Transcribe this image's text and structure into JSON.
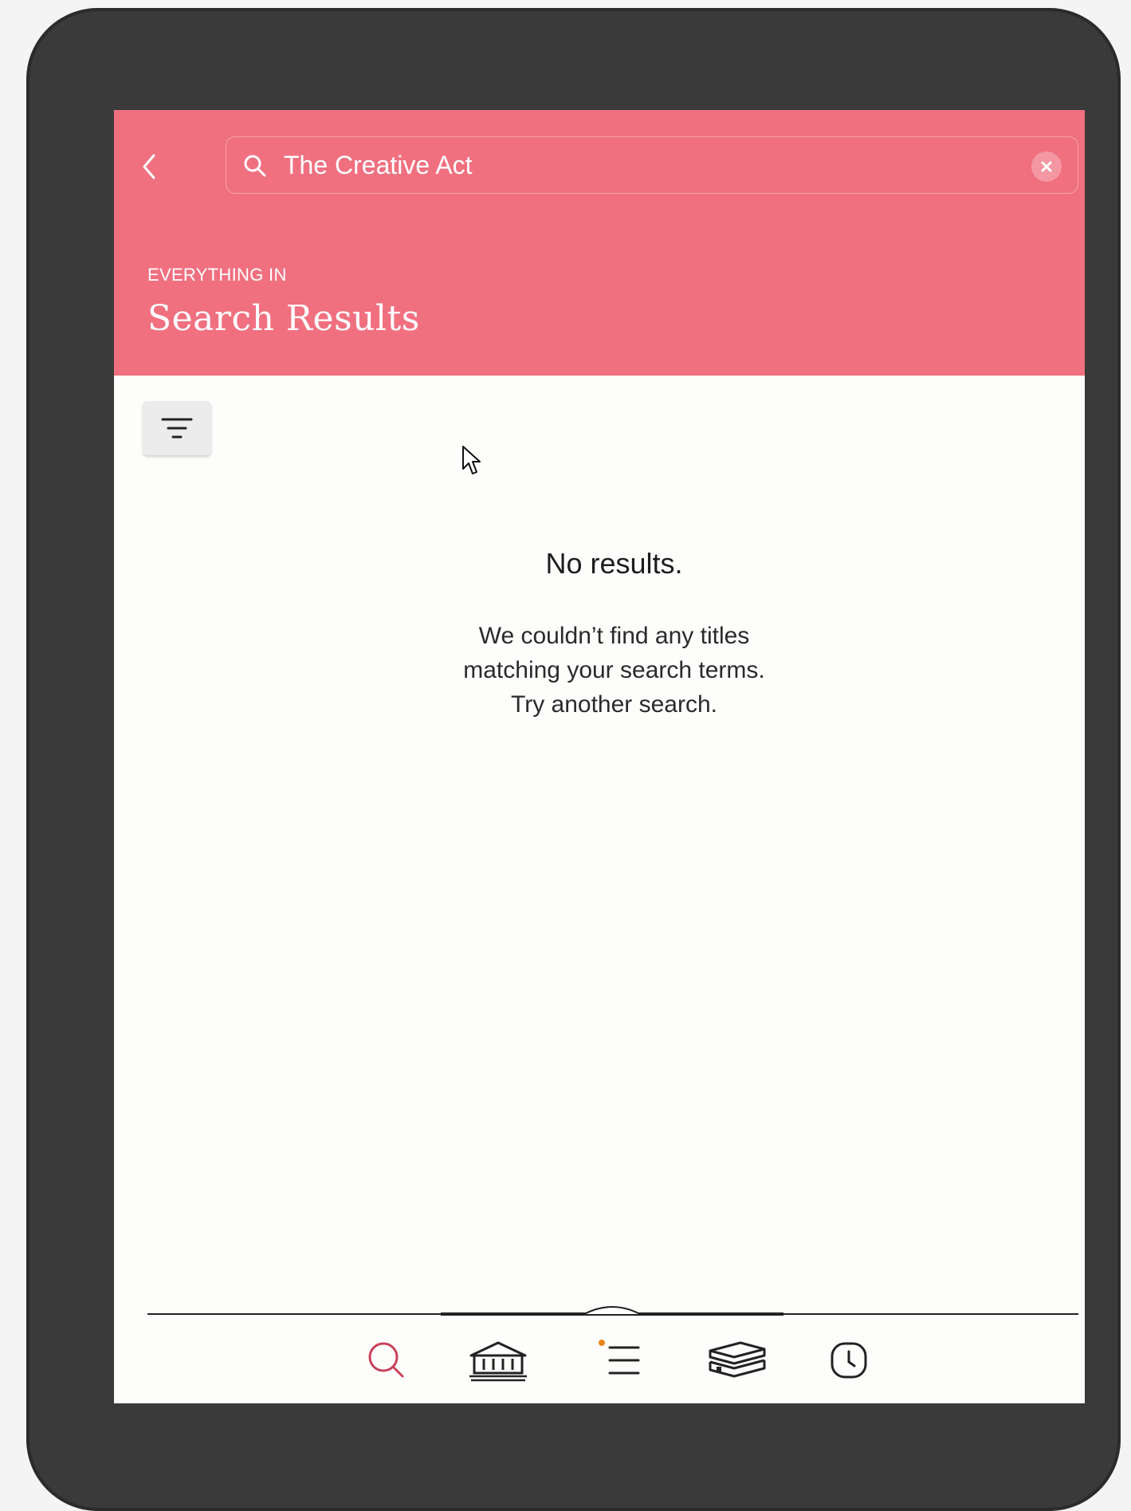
{
  "search": {
    "value": "The Creative Act",
    "placeholder": ""
  },
  "header": {
    "eyebrow": "EVERYTHING IN",
    "title": "Search Results"
  },
  "empty_state": {
    "title": "No results.",
    "lines": [
      "We couldn’t find any titles",
      "matching your search terms.",
      "Try another search."
    ]
  },
  "bottom_nav": {
    "items": [
      {
        "icon": "search-icon",
        "active": true
      },
      {
        "icon": "library-icon",
        "active": false
      },
      {
        "icon": "menu-list-icon",
        "active": false,
        "notification_dot": true
      },
      {
        "icon": "books-stack-icon",
        "active": false
      },
      {
        "icon": "clock-icon",
        "active": false
      }
    ]
  },
  "colors": {
    "header_bg": "#f07080",
    "accent_active": "#c9415a",
    "notification_dot": "#e8841a",
    "device_frame": "#3a3a3a",
    "screen_bg": "#fdfdfb"
  }
}
